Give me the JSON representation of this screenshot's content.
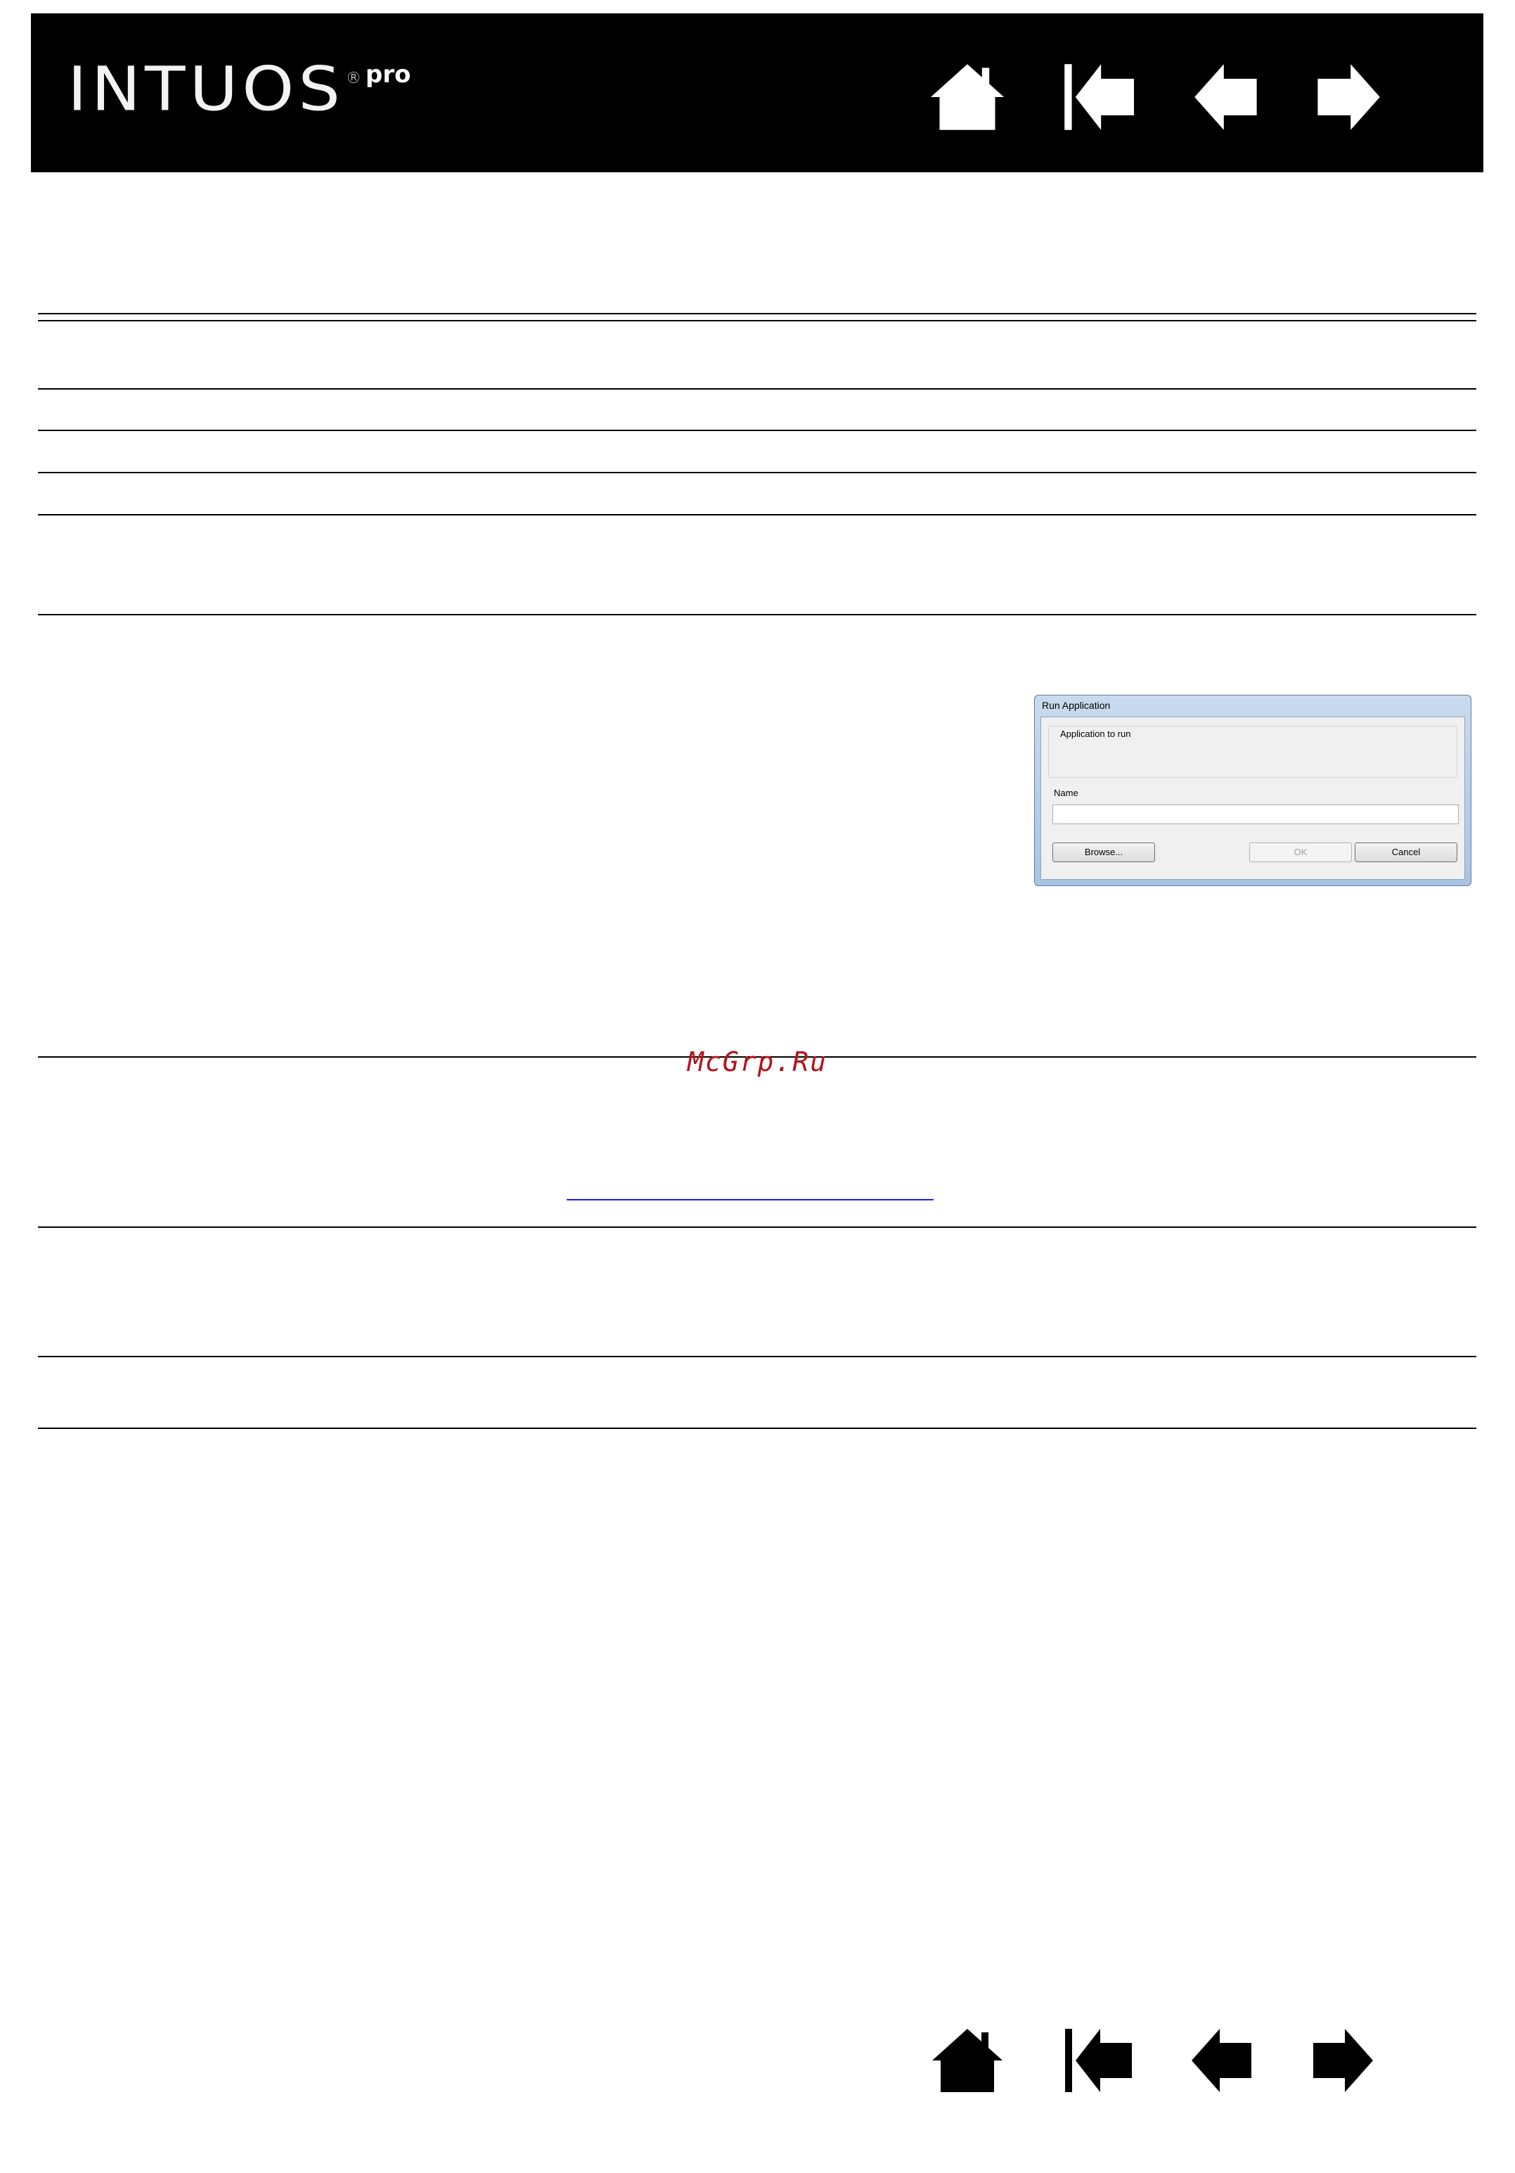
{
  "header": {
    "logo_text": "INTUOS",
    "logo_registered": "®",
    "logo_suffix": "pro",
    "background": "#000000"
  },
  "nav": {
    "buttons": [
      {
        "name": "home-button",
        "icon": "home-icon"
      },
      {
        "name": "first-page-button",
        "icon": "first-page-icon"
      },
      {
        "name": "previous-page-button",
        "icon": "previous-arrow-icon"
      },
      {
        "name": "next-page-button",
        "icon": "next-arrow-icon"
      }
    ]
  },
  "watermark": {
    "text": "McGrp.Ru",
    "color": "#b5121b"
  },
  "dialog": {
    "title": "Run Application",
    "group_label": "Application to run",
    "name_label": "Name",
    "name_value": "",
    "browse_label": "Browse...",
    "ok_label": "OK",
    "cancel_label": "Cancel",
    "ok_enabled": false
  }
}
